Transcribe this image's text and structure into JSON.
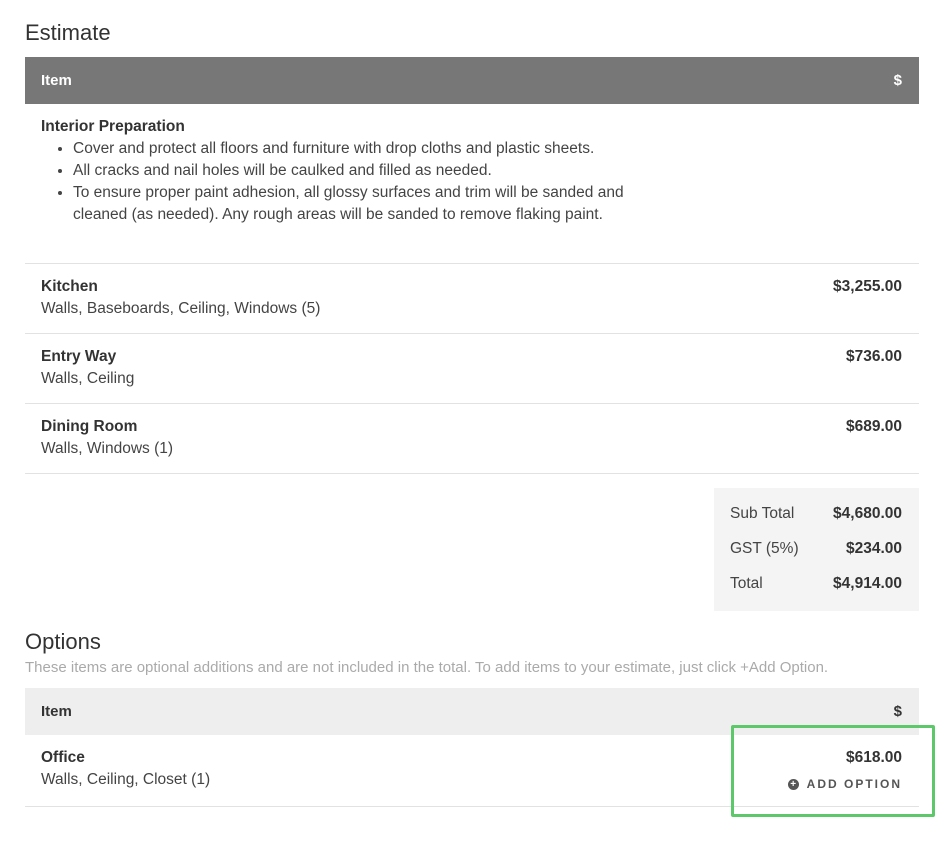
{
  "estimate": {
    "title": "Estimate",
    "header": {
      "item_label": "Item",
      "price_label": "$"
    },
    "prep": {
      "name": "Interior Preparation",
      "bullets": [
        "Cover and protect all floors and furniture with drop cloths and plastic sheets.",
        "All cracks and nail holes will be caulked and filled as needed.",
        "To ensure proper paint adhesion, all glossy surfaces and trim will be sanded and cleaned (as needed). Any rough areas will be sanded to remove flaking paint."
      ]
    },
    "rows": [
      {
        "name": "Kitchen",
        "desc": "Walls, Baseboards, Ceiling, Windows (5)",
        "price": "$3,255.00"
      },
      {
        "name": "Entry Way",
        "desc": "Walls, Ceiling",
        "price": "$736.00"
      },
      {
        "name": "Dining Room",
        "desc": "Walls, Windows (1)",
        "price": "$689.00"
      }
    ],
    "totals": {
      "subtotal_label": "Sub Total",
      "subtotal_value": "$4,680.00",
      "gst_label": "GST (5%)",
      "gst_value": "$234.00",
      "total_label": "Total",
      "total_value": "$4,914.00"
    }
  },
  "options": {
    "title": "Options",
    "subtitle": "These items are optional additions and are not included in the total. To add items to your estimate, just click +Add Option.",
    "header": {
      "item_label": "Item",
      "price_label": "$"
    },
    "rows": [
      {
        "name": "Office",
        "desc": "Walls, Ceiling, Closet (1)",
        "price": "$618.00",
        "action_label": "ADD OPTION"
      }
    ]
  },
  "icons": {
    "add_option": "plus-circle-icon"
  },
  "colors": {
    "header_dark": "#777777",
    "header_light": "#eeeeee",
    "totals_bg": "#f4f4f4",
    "highlight": "#5cc86a"
  }
}
